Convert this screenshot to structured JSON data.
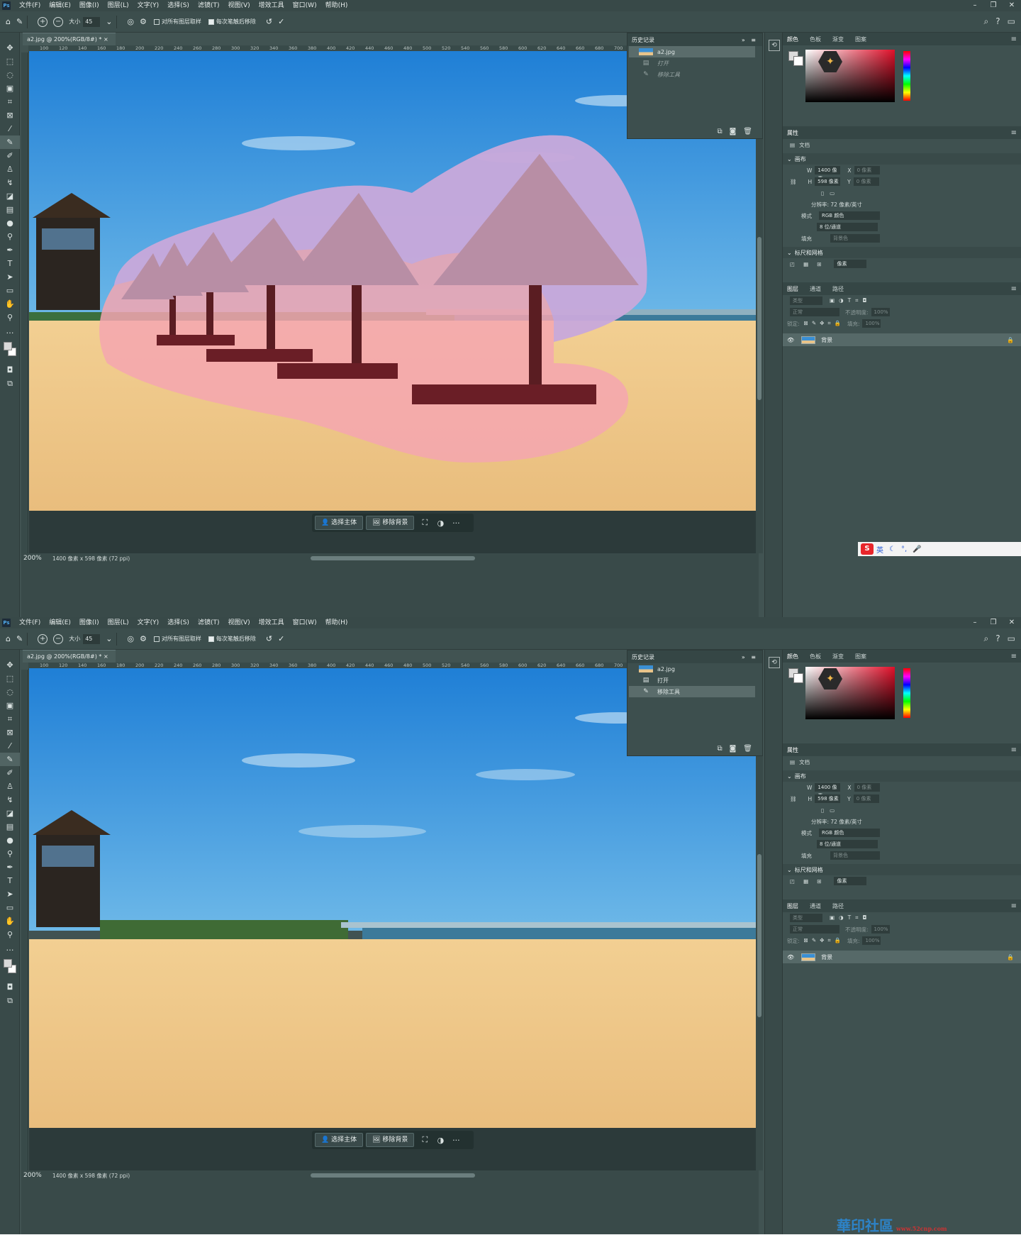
{
  "menu": [
    "文件(F)",
    "编辑(E)",
    "图像(I)",
    "图层(L)",
    "文字(Y)",
    "选择(S)",
    "滤镜(T)",
    "视图(V)",
    "增效工具",
    "窗口(W)",
    "帮助(H)"
  ],
  "options": {
    "size_label": "大小",
    "size_value": "45",
    "sample_all_layers": "对所有图层取样",
    "remove_after_stroke": "每次笔触后移除"
  },
  "document": {
    "tab_title": "a2.jpg @ 200%(RGB/8#) *",
    "zoom": "200%",
    "info": "1400 像素 x 598 像素 (72 ppi)"
  },
  "ruler_ticks": [
    "100",
    "120",
    "140",
    "160",
    "180",
    "200",
    "220",
    "240",
    "260",
    "280",
    "300",
    "320",
    "340",
    "360",
    "380",
    "400",
    "420",
    "440",
    "460",
    "480",
    "500",
    "520",
    "540",
    "560",
    "580",
    "600",
    "620",
    "640",
    "660",
    "680",
    "700"
  ],
  "context_bar": {
    "select_subject": "选择主体",
    "remove_background": "移除背景",
    "more": "···"
  },
  "history": {
    "title": "历史记录",
    "snapshot": "a2.jpg",
    "items": [
      "打开",
      "移除工具"
    ]
  },
  "color_panel": {
    "tabs": [
      "颜色",
      "色板",
      "渐变",
      "图案"
    ]
  },
  "properties": {
    "title": "属性",
    "doc_label": "文档",
    "canvas_title": "画布",
    "w_label": "W",
    "w_value": "1400 像素",
    "h_label": "H",
    "h_value": "598 像素",
    "x_label": "X",
    "y_label": "Y",
    "x_value": "0 像素",
    "y_value": "0 像素",
    "resolution": "分辨率: 72 像素/英寸",
    "mode_label": "模式",
    "mode_value": "RGB 颜色",
    "depth_value": "8 位/通道",
    "fill_label": "填充",
    "fill_value": "背景色",
    "ruler_grid_title": "标尺和网格",
    "unit_value": "像素"
  },
  "layers": {
    "tabs": [
      "图层",
      "通道",
      "路径"
    ],
    "search": "类型",
    "blend_mode": "正常",
    "opacity_label": "不透明度:",
    "opacity_value": "100%",
    "lock_label": "锁定:",
    "fill_label": "填充:",
    "fill_value": "100%",
    "layer_name": "背景"
  },
  "ime": {
    "lang": "英"
  },
  "watermark": {
    "text": "華印社區",
    "url": "www.52cnp.com"
  }
}
